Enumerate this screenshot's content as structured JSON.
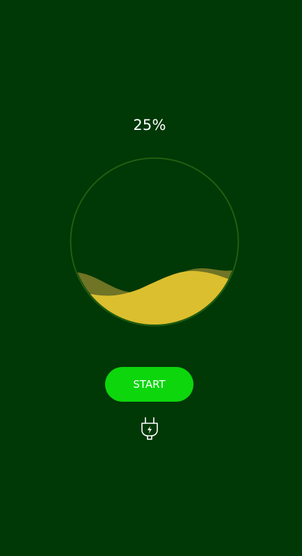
{
  "battery": {
    "percent_label": "25%",
    "level": 0.25
  },
  "colors": {
    "background": "#003806",
    "ring": "#1f6010",
    "wave_front": "#dbbf2e",
    "wave_back": "#707425",
    "button": "#0dd60d",
    "text": "#ffffff"
  },
  "controls": {
    "start_label": "START"
  },
  "icons": {
    "charger": "plug-icon"
  }
}
